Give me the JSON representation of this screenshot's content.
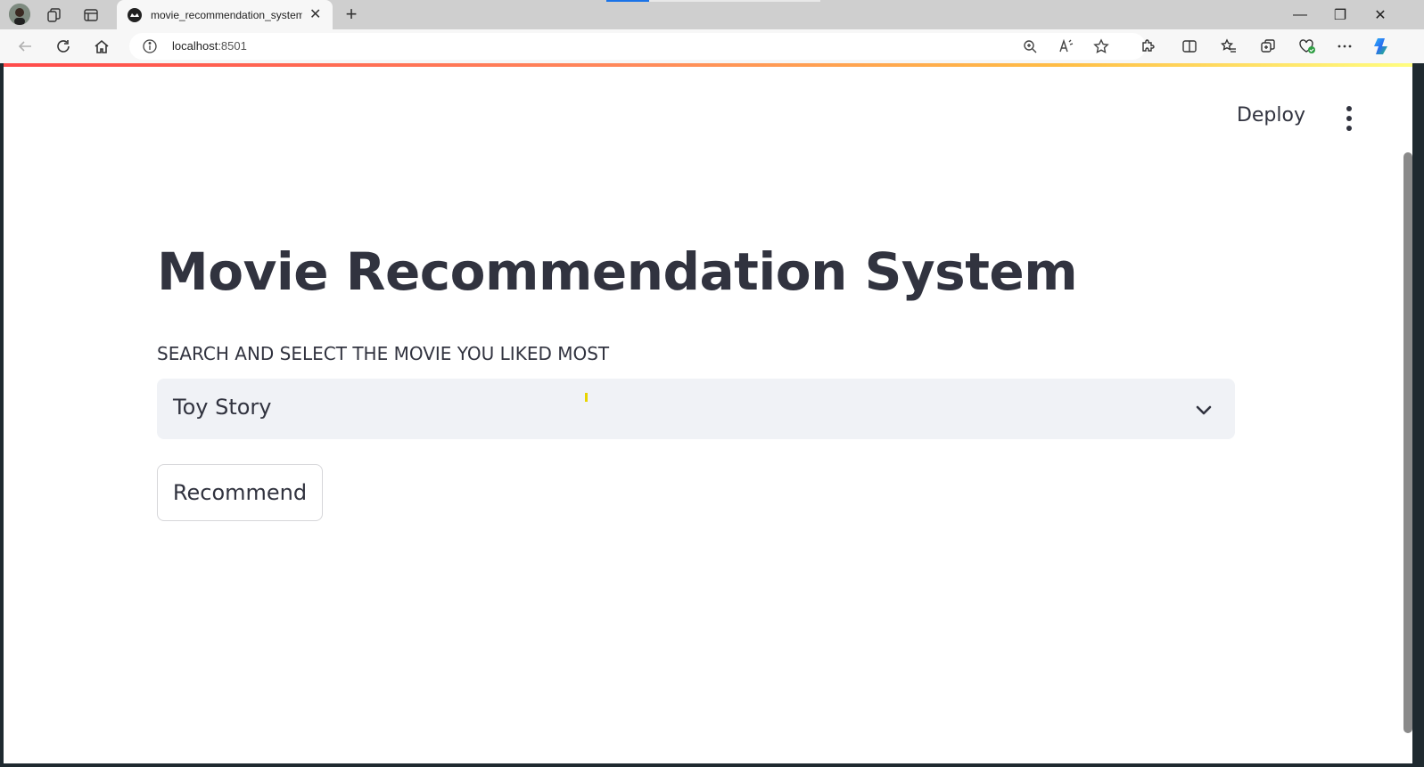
{
  "browser": {
    "tab": {
      "title": "movie_recommendation_system"
    },
    "new_tab_symbol": "+",
    "address": {
      "host": "localhost",
      "port": ":8501"
    },
    "window_controls": {
      "minimize": "—",
      "restore": "❐",
      "close": "✕"
    }
  },
  "app": {
    "deploy_label": "Deploy",
    "title": "Movie Recommendation System",
    "select_label": "SEARCH AND SELECT THE MOVIE YOU LIKED MOST",
    "selected_movie": "Toy Story",
    "recommend_label": "Recommend"
  },
  "colors": {
    "text": "#31333f",
    "select_bg": "#f0f2f6",
    "decoration_start": "#ff4b4b",
    "decoration_end": "#fffd80"
  }
}
